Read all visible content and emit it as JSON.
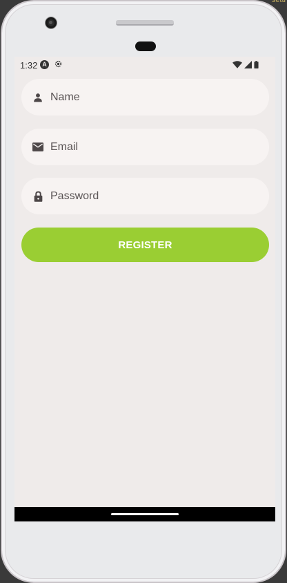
{
  "corner": {
    "text": "setti"
  },
  "status_bar": {
    "time": "1:32",
    "left_icons": [
      "app-a-icon",
      "settings-gear-icon"
    ],
    "right_icons": [
      "wifi-icon",
      "cell-signal-icon",
      "battery-icon"
    ]
  },
  "form": {
    "fields": [
      {
        "icon": "person-icon",
        "placeholder": "Name"
      },
      {
        "icon": "mail-icon",
        "placeholder": "Email"
      },
      {
        "icon": "lock-icon",
        "placeholder": "Password"
      }
    ],
    "register_label": "REGISTER"
  },
  "colors": {
    "accent": "#9ace33",
    "background": "#efebea",
    "field_bg": "#f7f3f2"
  }
}
